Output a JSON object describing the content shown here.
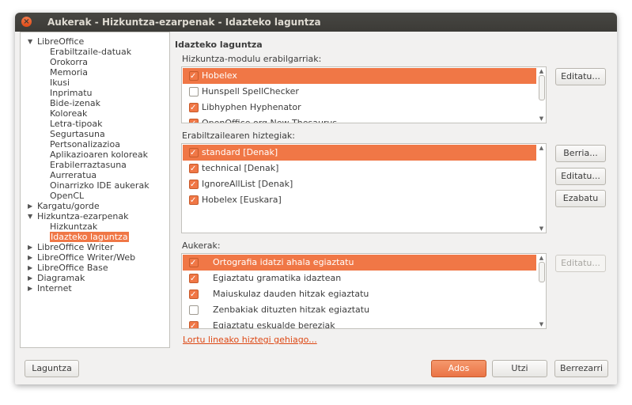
{
  "window": {
    "title": "Aukerak - Hizkuntza-ezarpenak - Idazteko laguntza",
    "close_icon": "close-icon"
  },
  "tree": [
    {
      "label": "LibreOffice",
      "level": 0,
      "expanded": true
    },
    {
      "label": "Erabiltzaile-datuak",
      "level": 1
    },
    {
      "label": "Orokorra",
      "level": 1
    },
    {
      "label": "Memoria",
      "level": 1
    },
    {
      "label": "Ikusi",
      "level": 1
    },
    {
      "label": "Inprimatu",
      "level": 1
    },
    {
      "label": "Bide-izenak",
      "level": 1
    },
    {
      "label": "Koloreak",
      "level": 1
    },
    {
      "label": "Letra-tipoak",
      "level": 1
    },
    {
      "label": "Segurtasuna",
      "level": 1
    },
    {
      "label": "Pertsonalizazioa",
      "level": 1
    },
    {
      "label": "Aplikazioaren koloreak",
      "level": 1
    },
    {
      "label": "Erabilerraztasuna",
      "level": 1
    },
    {
      "label": "Aurreratua",
      "level": 1
    },
    {
      "label": "Oinarrizko IDE aukerak",
      "level": 1
    },
    {
      "label": "OpenCL",
      "level": 1
    },
    {
      "label": "Kargatu/gorde",
      "level": 0,
      "expanded": false
    },
    {
      "label": "Hizkuntza-ezarpenak",
      "level": 0,
      "expanded": true
    },
    {
      "label": "Hizkuntzak",
      "level": 1
    },
    {
      "label": "Idazteko laguntza",
      "level": 1,
      "selected": true
    },
    {
      "label": "LibreOffice Writer",
      "level": 0,
      "expanded": false
    },
    {
      "label": "LibreOffice Writer/Web",
      "level": 0,
      "expanded": false
    },
    {
      "label": "LibreOffice Base",
      "level": 0,
      "expanded": false
    },
    {
      "label": "Diagramak",
      "level": 0,
      "expanded": false
    },
    {
      "label": "Internet",
      "level": 0,
      "expanded": false
    }
  ],
  "page": {
    "title": "Idazteko laguntza",
    "modules_label": "Hizkuntza-modulu erabilgarriak:",
    "modules": [
      {
        "label": "Hobelex",
        "checked": true,
        "selected": true
      },
      {
        "label": "Hunspell SpellChecker",
        "checked": false
      },
      {
        "label": "Libhyphen Hyphenator",
        "checked": true
      },
      {
        "label": "OpenOffice.org New Thesaurus",
        "checked": true
      }
    ],
    "modules_edit": "Editatu...",
    "dicts_label": "Erabiltzailearen hiztegiak:",
    "dicts": [
      {
        "label": "standard [Denak]",
        "checked": true,
        "selected": true
      },
      {
        "label": "technical [Denak]",
        "checked": true
      },
      {
        "label": "IgnoreAllList [Denak]",
        "checked": true
      },
      {
        "label": "Hobelex [Euskara]",
        "checked": true
      }
    ],
    "dicts_new": "Berria...",
    "dicts_edit": "Editatu...",
    "dicts_delete": "Ezabatu",
    "options_label": "Aukerak:",
    "options": [
      {
        "label": "Ortografia idatzi ahala egiaztatu",
        "checked": true,
        "selected": true
      },
      {
        "label": "Egiaztatu gramatika idaztean",
        "checked": true
      },
      {
        "label": "Maiuskulaz dauden hitzak egiaztatu",
        "checked": true
      },
      {
        "label": "Zenbakiak dituzten hitzak egiaztatu",
        "checked": false
      },
      {
        "label": "Egiaztatu eskualde bereziak",
        "checked": true
      }
    ],
    "options_edit": "Editatu...",
    "more_link": "Lortu lineako hiztegi gehiago..."
  },
  "footer": {
    "help": "Laguntza",
    "ok": "Ados",
    "cancel": "Utzi",
    "reset": "Berrezarri"
  }
}
